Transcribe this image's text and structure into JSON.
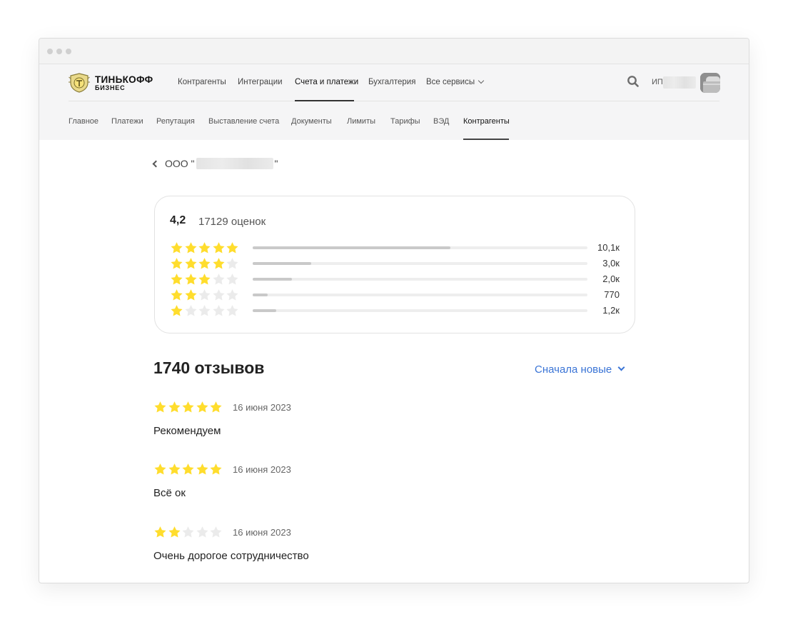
{
  "header": {
    "logo": {
      "line1": "ТИНЬКОФФ",
      "line2": "БИЗНЕС"
    },
    "top_nav": [
      {
        "label": "Контрагенты",
        "active": false
      },
      {
        "label": "Интеграции",
        "active": false
      },
      {
        "label": "Счета и платежи",
        "active": true
      },
      {
        "label": "Бухгалтерия",
        "active": false
      },
      {
        "label": "Все сервисы",
        "active": false,
        "dropdown": true
      }
    ],
    "user": {
      "prefix": "ИП"
    },
    "sub_nav": [
      {
        "label": "Главное",
        "active": false
      },
      {
        "label": "Платежи",
        "active": false
      },
      {
        "label": "Репутация",
        "active": false
      },
      {
        "label": "Выставление счета",
        "active": false
      },
      {
        "label": "Документы",
        "active": false
      },
      {
        "label": "Лимиты",
        "active": false
      },
      {
        "label": "Тарифы",
        "active": false
      },
      {
        "label": "ВЭД",
        "active": false
      },
      {
        "label": "Контрагенты",
        "active": true
      }
    ]
  },
  "company": {
    "prefix": "ООО \"",
    "suffix": "\""
  },
  "rating": {
    "average": "4,2",
    "count_label": "17129 оценок",
    "rows": [
      {
        "stars": 5,
        "fraction": 0.59,
        "count": "10,1к"
      },
      {
        "stars": 4,
        "fraction": 0.175,
        "count": "3,0к"
      },
      {
        "stars": 3,
        "fraction": 0.117,
        "count": "2,0к"
      },
      {
        "stars": 2,
        "fraction": 0.045,
        "count": "770"
      },
      {
        "stars": 1,
        "fraction": 0.07,
        "count": "1,2к"
      }
    ]
  },
  "reviews": {
    "title": "1740 отзывов",
    "sort_label": "Сначала новые",
    "items": [
      {
        "stars": 5,
        "date": "16 июня 2023",
        "text": "Рекомендуем"
      },
      {
        "stars": 5,
        "date": "16 июня 2023",
        "text": "Всё ок"
      },
      {
        "stars": 2,
        "date": "16 июня 2023",
        "text": "Очень дорогое сотрудничество"
      }
    ]
  },
  "colors": {
    "star_filled": "#FFDD2D",
    "star_empty": "#EBEBEB",
    "link": "#3A74D6",
    "bar_fill": "#C9C9C9",
    "bar_track": "#EEEEEE"
  },
  "icons": {
    "search": "search-icon",
    "back": "chevron-left-icon",
    "sort": "chevron-down-icon",
    "avatar": "briefcase-avatar-icon"
  }
}
